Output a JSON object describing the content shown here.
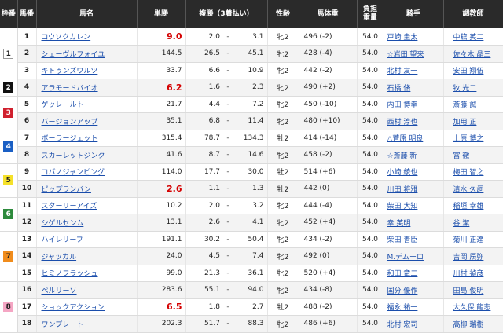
{
  "headers": {
    "waku": "枠番",
    "uma": "馬番",
    "name": "馬名",
    "odds": "単勝",
    "fukusho": "複勝（3着払い）",
    "sex": "性齢",
    "weight": "馬体重",
    "kin_line1": "負担",
    "kin_line2": "重量",
    "jockey": "騎手",
    "trainer": "調教師"
  },
  "waku_colors": {
    "1": {
      "bg": "#ffffff",
      "fg": "#222222"
    },
    "2": {
      "bg": "#111111",
      "fg": "#ffffff"
    },
    "3": {
      "bg": "#d0202e",
      "fg": "#ffffff"
    },
    "4": {
      "bg": "#1a5fc4",
      "fg": "#ffffff"
    },
    "5": {
      "bg": "#f5e12a",
      "fg": "#222222"
    },
    "6": {
      "bg": "#2d8a3c",
      "fg": "#ffffff"
    },
    "7": {
      "bg": "#f08c1c",
      "fg": "#222222"
    },
    "8": {
      "bg": "#f5a6c4",
      "fg": "#222222"
    }
  },
  "odds_highlight_color": "#d40000",
  "rows": [
    {
      "waku": "1",
      "uma": "1",
      "name": "コウソクカレン",
      "odds": "9.0",
      "hot": true,
      "fmin": "2.0",
      "dash": "-",
      "fmax": "3.1",
      "sex": "牝2",
      "weight": "496 (-2)",
      "kin": "54.0",
      "jockey": "戸崎 圭太",
      "trainer": "中舘 英二"
    },
    {
      "waku": "",
      "uma": "2",
      "name": "シェーヴルフォイユ",
      "odds": "144.5",
      "hot": false,
      "fmin": "26.5",
      "dash": "-",
      "fmax": "45.1",
      "sex": "牝2",
      "weight": "428 (-4)",
      "kin": "54.0",
      "jockey": "☆岩田 望来",
      "trainer": "佐々木 晶三"
    },
    {
      "waku": "",
      "uma": "3",
      "name": "キトゥンズワルツ",
      "odds": "33.7",
      "hot": false,
      "fmin": "6.6",
      "dash": "-",
      "fmax": "10.9",
      "sex": "牝2",
      "weight": "442 (-2)",
      "kin": "54.0",
      "jockey": "北村 友一",
      "trainer": "安田 翔伍"
    },
    {
      "waku": "2",
      "uma": "4",
      "name": "アラモードバイオ",
      "odds": "6.2",
      "hot": true,
      "fmin": "1.6",
      "dash": "-",
      "fmax": "2.3",
      "sex": "牝2",
      "weight": "490 (+2)",
      "kin": "54.0",
      "jockey": "石橋 脩",
      "trainer": "牧 光二"
    },
    {
      "waku": "3",
      "uma": "5",
      "name": "ゲッレールト",
      "odds": "21.7",
      "hot": false,
      "fmin": "4.4",
      "dash": "-",
      "fmax": "7.2",
      "sex": "牝2",
      "weight": "450 (-10)",
      "kin": "54.0",
      "jockey": "内田 博幸",
      "trainer": "斎藤 誠"
    },
    {
      "waku": "",
      "uma": "6",
      "name": "バージョンアップ",
      "odds": "35.1",
      "hot": false,
      "fmin": "6.8",
      "dash": "-",
      "fmax": "11.4",
      "sex": "牝2",
      "weight": "480 (+10)",
      "kin": "54.0",
      "jockey": "西村 淳也",
      "trainer": "加用 正"
    },
    {
      "waku": "4",
      "uma": "7",
      "name": "ボーラージェット",
      "odds": "315.4",
      "hot": false,
      "fmin": "78.7",
      "dash": "-",
      "fmax": "134.3",
      "sex": "牡2",
      "weight": "414 (-14)",
      "kin": "54.0",
      "jockey": "△菅原 明良",
      "trainer": "上原 博之"
    },
    {
      "waku": "",
      "uma": "8",
      "name": "スカーレットジンク",
      "odds": "41.6",
      "hot": false,
      "fmin": "8.7",
      "dash": "-",
      "fmax": "14.6",
      "sex": "牝2",
      "weight": "458 (-2)",
      "kin": "54.0",
      "jockey": "☆斎藤 新",
      "trainer": "宮 徹"
    },
    {
      "waku": "5",
      "uma": "9",
      "name": "コパノジャンピング",
      "odds": "114.0",
      "hot": false,
      "fmin": "17.7",
      "dash": "-",
      "fmax": "30.0",
      "sex": "牡2",
      "weight": "514 (+6)",
      "kin": "54.0",
      "jockey": "小崎 綾也",
      "trainer": "梅田 智之"
    },
    {
      "waku": "",
      "uma": "10",
      "name": "ピップランバン",
      "odds": "2.6",
      "hot": true,
      "fmin": "1.1",
      "dash": "-",
      "fmax": "1.3",
      "sex": "牡2",
      "weight": "442 (0)",
      "kin": "54.0",
      "jockey": "川田 将雅",
      "trainer": "清水 久詞"
    },
    {
      "waku": "6",
      "uma": "11",
      "name": "スターリーアイズ",
      "odds": "10.2",
      "hot": false,
      "fmin": "2.0",
      "dash": "-",
      "fmax": "3.2",
      "sex": "牝2",
      "weight": "444 (-4)",
      "kin": "54.0",
      "jockey": "柴田 大知",
      "trainer": "稲垣 幸雄"
    },
    {
      "waku": "",
      "uma": "12",
      "name": "シゲルセンム",
      "odds": "13.1",
      "hot": false,
      "fmin": "2.6",
      "dash": "-",
      "fmax": "4.1",
      "sex": "牝2",
      "weight": "452 (+4)",
      "kin": "54.0",
      "jockey": "幸 英明",
      "trainer": "谷 潔"
    },
    {
      "waku": "7",
      "uma": "13",
      "name": "ハイレリーフ",
      "odds": "191.1",
      "hot": false,
      "fmin": "30.2",
      "dash": "-",
      "fmax": "50.4",
      "sex": "牝2",
      "weight": "434 (-2)",
      "kin": "54.0",
      "jockey": "柴田 善臣",
      "trainer": "菊川 正達"
    },
    {
      "waku": "",
      "uma": "14",
      "name": "ジャッカル",
      "odds": "24.0",
      "hot": false,
      "fmin": "4.5",
      "dash": "-",
      "fmax": "7.4",
      "sex": "牝2",
      "weight": "492 (0)",
      "kin": "54.0",
      "jockey": "M.デムーロ",
      "trainer": "吉岡 辰弥"
    },
    {
      "waku": "",
      "uma": "15",
      "name": "ヒミノフラッシュ",
      "odds": "99.0",
      "hot": false,
      "fmin": "21.3",
      "dash": "-",
      "fmax": "36.1",
      "sex": "牝2",
      "weight": "520 (+4)",
      "kin": "54.0",
      "jockey": "和田 竜二",
      "trainer": "川村 禎彦"
    },
    {
      "waku": "8",
      "uma": "16",
      "name": "ペルリーソ",
      "odds": "283.6",
      "hot": false,
      "fmin": "55.1",
      "dash": "-",
      "fmax": "94.0",
      "sex": "牝2",
      "weight": "434 (-8)",
      "kin": "54.0",
      "jockey": "国分 優作",
      "trainer": "田島 俊明"
    },
    {
      "waku": "",
      "uma": "17",
      "name": "ショックアクション",
      "odds": "6.5",
      "hot": true,
      "fmin": "1.8",
      "dash": "-",
      "fmax": "2.7",
      "sex": "牡2",
      "weight": "488 (-2)",
      "kin": "54.0",
      "jockey": "福永 祐一",
      "trainer": "大久保 龍志"
    },
    {
      "waku": "",
      "uma": "18",
      "name": "ワンプレート",
      "odds": "202.3",
      "hot": false,
      "fmin": "51.7",
      "dash": "-",
      "fmax": "88.3",
      "sex": "牝2",
      "weight": "486 (+6)",
      "kin": "54.0",
      "jockey": "北村 宏司",
      "trainer": "高柳 瑞樹"
    }
  ]
}
